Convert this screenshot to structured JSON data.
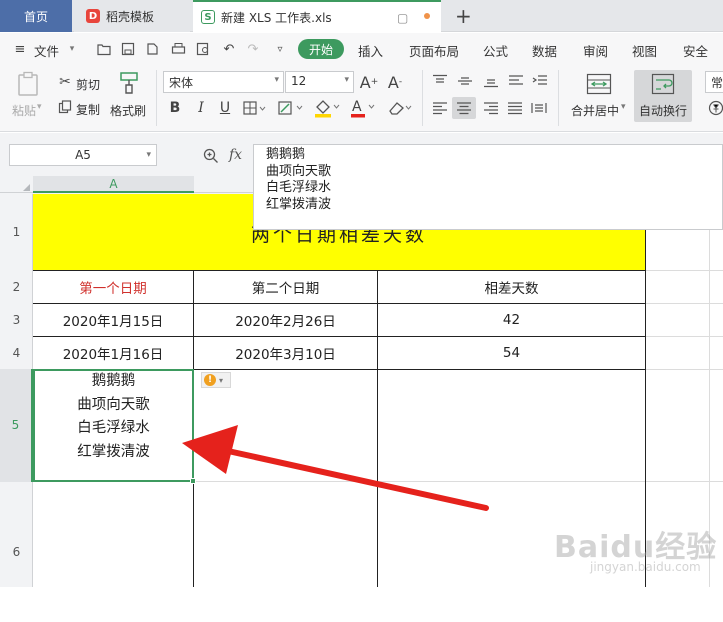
{
  "tabs": {
    "home": "首页",
    "docer": "稻壳模板",
    "file": "新建 XLS 工作表.xls",
    "new_tab": "+"
  },
  "menu": {
    "file": "文件",
    "items": [
      "开始",
      "插入",
      "页面布局",
      "公式",
      "数据",
      "审阅",
      "视图",
      "安全"
    ]
  },
  "ribbon": {
    "paste": "粘贴",
    "cut": "剪切",
    "copy": "复制",
    "format_painter": "格式刷",
    "font_name": "宋体",
    "font_size": "12",
    "merge_center": "合并居中",
    "auto_wrap": "自动换行",
    "more": "常"
  },
  "formula_bar": {
    "cell_ref": "A5",
    "fx": "fx",
    "lines": [
      "鹅鹅鹅",
      "曲项向天歌",
      "白毛浮绿水",
      "红掌拨清波"
    ]
  },
  "sheet": {
    "selected_column": "A",
    "row_labels": [
      "1",
      "2",
      "3",
      "4",
      "5",
      "6"
    ],
    "title": "两个日期相差天数",
    "headers": [
      "第一个日期",
      "第二个日期",
      "相差天数"
    ],
    "rows": [
      [
        "2020年1月15日",
        "2020年2月26日",
        "42"
      ],
      [
        "2020年1月16日",
        "2020年3月10日",
        "54"
      ]
    ],
    "a5_lines": [
      "鹅鹅鹅",
      "曲项向天歌",
      "白毛浮绿水",
      "红掌拨清波"
    ]
  },
  "colors": {
    "accent": "#3d9a5f",
    "title_fill": "#ffff00",
    "header_red": "#d0312d",
    "arrow_red": "#e5221c"
  },
  "watermark": {
    "brand": "Baidu经验",
    "sub": "jingyan.baidu.com"
  }
}
